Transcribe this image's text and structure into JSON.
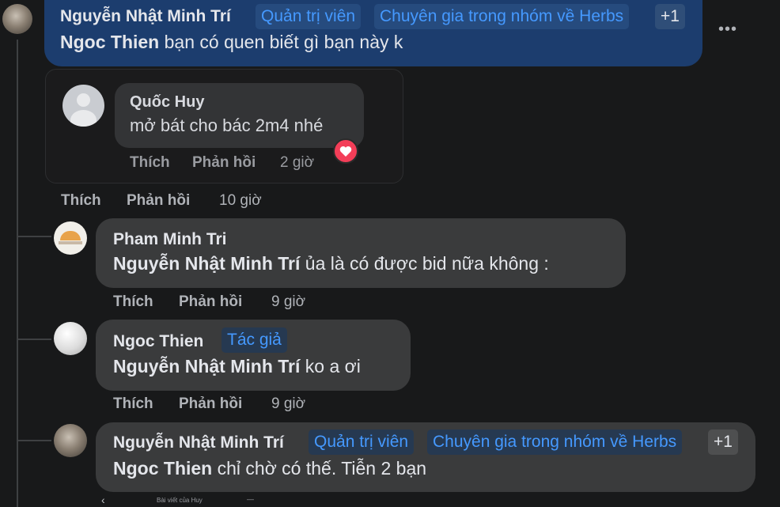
{
  "comment_top": {
    "author": "Nguyễn Nhật Minh Trí",
    "badges": [
      "Quản trị viên",
      "Chuyên gia trong nhóm về Herbs",
      "+1"
    ],
    "mention": "Ngoc Thien",
    "text": " bạn có quen biết gì bạn này k",
    "menu": "•••"
  },
  "shared_image": {
    "author": "Quốc Huy",
    "text": "mở bát cho bác 2m4 nhé",
    "like": "Thích",
    "reply": "Phản hồi",
    "time": "2 giờ"
  },
  "comment_top_actions": {
    "like": "Thích",
    "reply": "Phản hồi",
    "time": "10 giờ"
  },
  "replies": [
    {
      "author": "Pham Minh Tri",
      "mention": "Nguyễn Nhật Minh Trí",
      "text": " ủa là có được bid nữa không :",
      "like": "Thích",
      "reply": "Phản hồi",
      "time": "9 giờ"
    },
    {
      "author": "Ngoc Thien",
      "badge": "Tác giả",
      "mention": "Nguyễn Nhật Minh Trí",
      "text": " ko a ơi",
      "like": "Thích",
      "reply": "Phản hồi",
      "time": "9 giờ"
    },
    {
      "author": "Nguyễn Nhật Minh Trí",
      "badges": [
        "Quản trị viên",
        "Chuyên gia trong nhóm về Herbs",
        "+1"
      ],
      "mention": "Ngoc Thien",
      "text": " chỉ chờ có thế. Tiễn 2 bạn"
    }
  ],
  "bottom_strip": {
    "back_glyph": "‹",
    "caption": "Bài viết của Huy",
    "end_glyph": "—"
  },
  "colors": {
    "background": "#18191a",
    "bubble": "#3a3b3c",
    "bubble_highlight": "#1c3d6e",
    "badge_blue": "#4599ff",
    "heart": "#f33e58"
  }
}
